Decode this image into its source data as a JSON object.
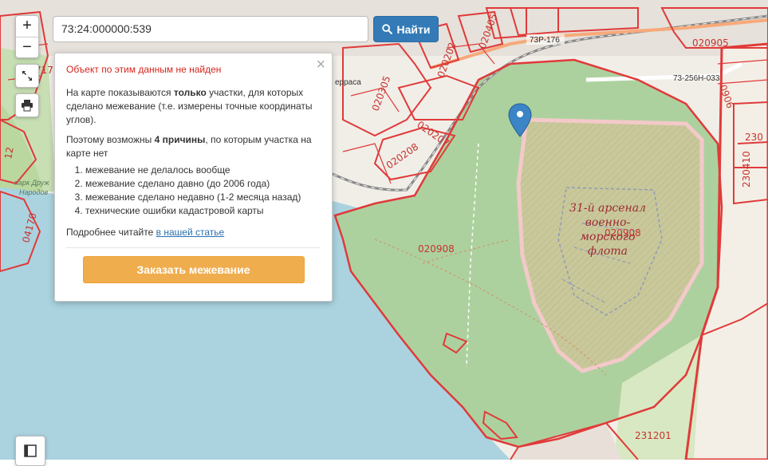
{
  "search": {
    "value": "73:24:000000:539",
    "button_label": "Найти"
  },
  "controls": {
    "zoom_in": "+",
    "zoom_out": "−"
  },
  "popup": {
    "error": "Объект по этим данным не найден",
    "p1_a": "На карте показываются ",
    "p1_b": "только",
    "p1_c": " участки, для которых сделано межевание (т.е. измерены точные координаты углов).",
    "p2_a": "Поэтому возможны ",
    "p2_b": "4 причины",
    "p2_c": ", по которым участка на карте нет",
    "reasons": [
      "межевание не делалось вообще",
      "межевание сделано давно (до 2006 года)",
      "межевание сделано недавно (1-2 месяца назад)",
      "технические ошибки кадастровой карты"
    ],
    "more_text": "Подробнее читайте ",
    "more_link": "в нашей статье",
    "order_button": "Заказать межевание",
    "close": "×"
  },
  "map": {
    "labels": {
      "l020908a": "020908",
      "l020908b": "020908",
      "l231201": "231201",
      "l020905": "020905",
      "l020305": "020305",
      "l020207": "020207",
      "l020208": "020208",
      "l020202": "020202",
      "l020405": "020405",
      "l230410": "230410",
      "l230": "230",
      "l0906": "0906",
      "l041707": "04170",
      "l717": "717",
      "l12": "12"
    },
    "roads": {
      "r73p176": "73Р-176",
      "r73256": "73-256Н-033"
    },
    "poi": {
      "line1": "31-й арсенал",
      "line2": "военно-",
      "line3": "морского",
      "line4": "флота"
    },
    "small": {
      "park1": "парк Друж",
      "park2": "Народов",
      "terrasa": "ерраса"
    },
    "colors": {
      "parcel": "#e03a3a",
      "water": "#aad3df",
      "forest": "#add19e",
      "military": "#c9c89a"
    }
  }
}
